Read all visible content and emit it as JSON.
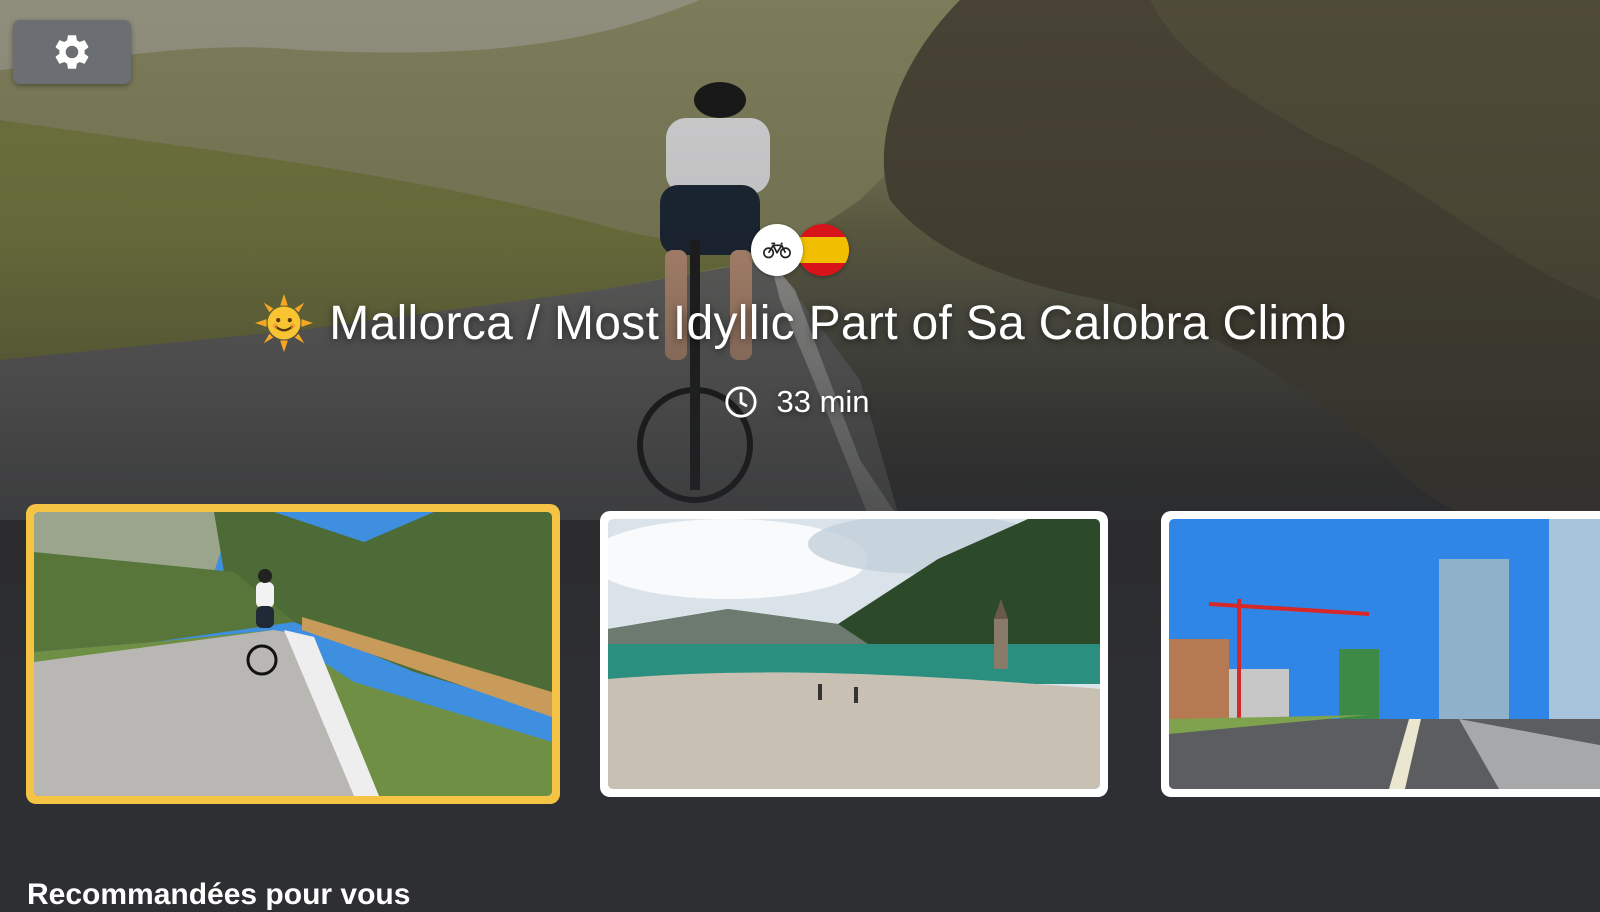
{
  "hero": {
    "title": "Mallorca / Most Idyllic Part of Sa Calobra Climb",
    "duration": "33 min",
    "weather_icon": "sun-face-icon",
    "activity_icon": "bicycle-icon",
    "country_flag_icon": "spain-flag-icon"
  },
  "toolbar": {
    "settings_icon": "gear-icon"
  },
  "carousel": {
    "selected_index": 0,
    "selected_border_color": "#f6c445",
    "items": [
      {
        "scene": "cyclist on mountain road with guardrail"
      },
      {
        "scene": "lake with submerged bell tower"
      },
      {
        "scene": "city street with tall buildings and crane"
      }
    ]
  },
  "section": {
    "heading": "Recommandées pour vous"
  },
  "colors": {
    "background": "#2e2f32",
    "accent": "#f6c445",
    "settings_button": "#6b6e73",
    "text": "#ffffff"
  }
}
